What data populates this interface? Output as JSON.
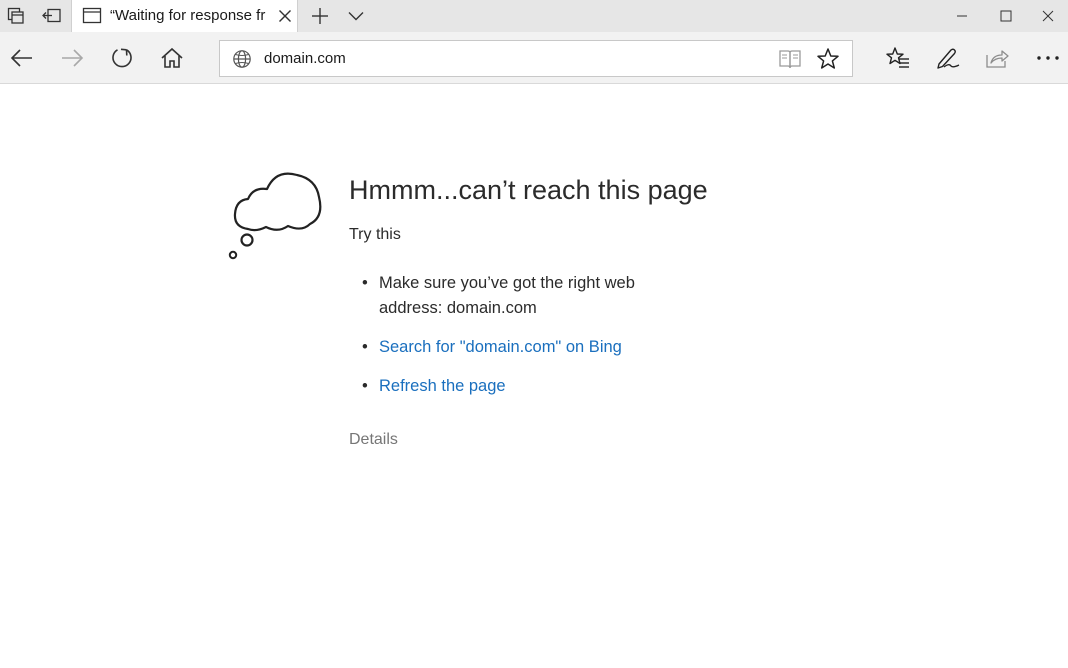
{
  "tab": {
    "title": "“Waiting for response fr",
    "close_glyph": "✕"
  },
  "address": {
    "url": "domain.com"
  },
  "error": {
    "title": "Hmmm...can’t reach this page",
    "try_this": "Try this",
    "bullet": "•",
    "tip1": "Make sure you’ve got the right web address: domain.com",
    "tip2": "Search for \"domain.com\" on Bing",
    "tip3": "Refresh the page",
    "details": "Details"
  },
  "colors": {
    "link": "#1a6fbe",
    "titlebar": "#e6e6e6",
    "navbar": "#f2f2f2"
  }
}
